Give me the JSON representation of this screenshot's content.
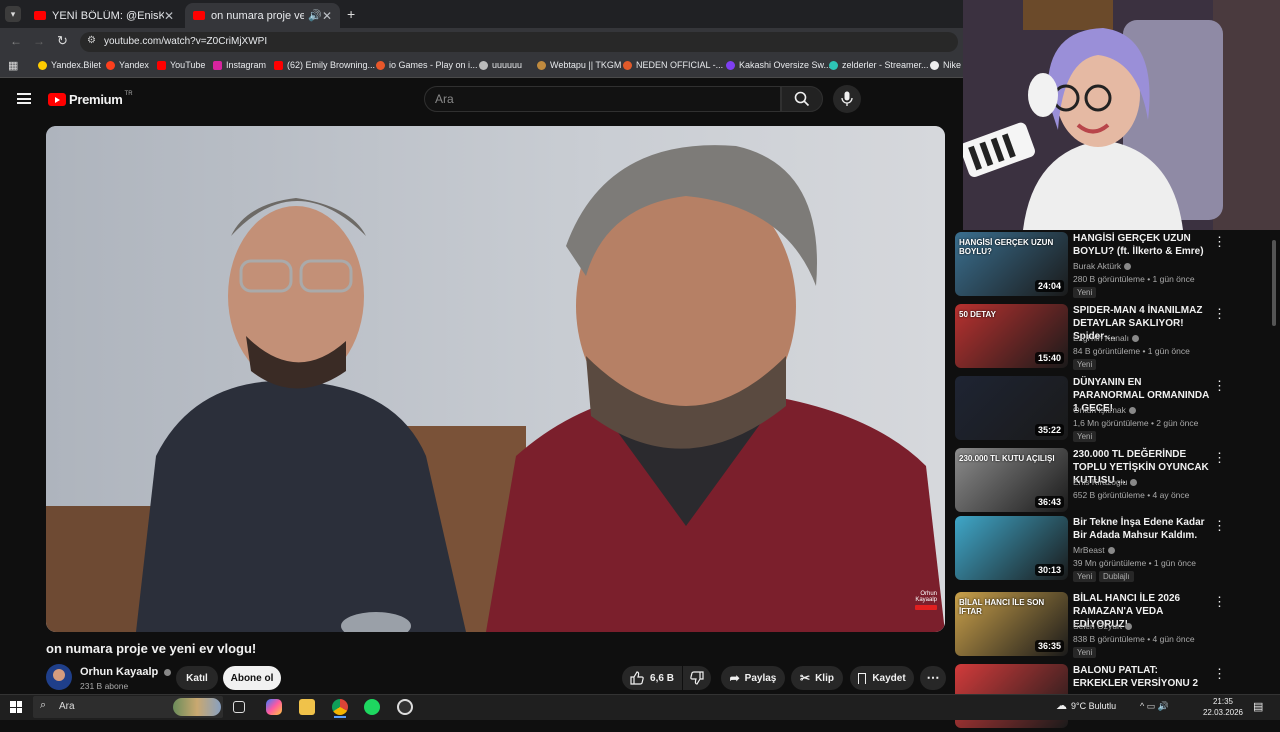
{
  "browser": {
    "tabs": [
      {
        "title": "YENİ BÖLÜM: @EnisKirazogluvlo",
        "active": false
      },
      {
        "title": "on numara proje ve yeni ev",
        "active": true
      }
    ],
    "url": "youtube.com/watch?v=Z0CriMjXWPI",
    "bookmarks": [
      "Yandex.Bilet",
      "Yandex",
      "YouTube",
      "Instagram",
      "(62) Emily Browning...",
      "io Games - Play on i...",
      "uuuuuu",
      "Webtapu || TKGM",
      "NEDEN OFFICIAL -...",
      "Kakashi Oversize Sw...",
      "zelderler - Streamer...",
      "Nike"
    ]
  },
  "youtube": {
    "logo": "Premium",
    "logo_region": "TR",
    "search_placeholder": "Ara"
  },
  "video": {
    "title": "on numara proje ve yeni ev vlogu!",
    "channel": "Orhun Kayaalp",
    "subscribers": "231 B abone",
    "join_label": "Katıl",
    "subscribe_label": "Abone ol",
    "likes": "6,6 B",
    "share_label": "Paylaş",
    "clip_label": "Klip",
    "save_label": "Kaydet",
    "watermark": "Orhun Kayaalp"
  },
  "recommendations": [
    {
      "title": "HANGİSİ GERÇEK UZUN BOYLU? (ft. İlkerto & Emre)",
      "channel": "Burak Aktürk",
      "meta": "280 B görüntüleme • 1 gün önce",
      "duration": "24:04",
      "badge": "Yeni",
      "thumb_text": "HANGİSİ GERÇEK UZUN BOYLU?",
      "thumb_color": "#3a6f8f"
    },
    {
      "title": "SPIDER-MAN 4 İNANILMAZ DETAYLAR SAKLIYOR! Spider-...",
      "channel": "Ezgi'nin Kanalı",
      "meta": "84 B görüntüleme • 1 gün önce",
      "duration": "15:40",
      "badge": "Yeni",
      "thumb_text": "50 DETAY",
      "thumb_color": "#b8312f"
    },
    {
      "title": "DÜNYANIN EN PARANORMAL ORMANINDA 1 GECE!",
      "channel": "Orkun Işıtmak",
      "meta": "1,6 Mn görüntüleme • 2 gün önce",
      "duration": "35:22",
      "badge": "Yeni",
      "thumb_text": "",
      "thumb_color": "#1e2433"
    },
    {
      "title": "230.000 TL DEĞERİNDE TOPLU YETİŞKİN OYUNCAK KUTUSU ...",
      "channel": "Enis Kirazoglu",
      "meta": "652 B görüntüleme • 4 ay önce",
      "duration": "36:43",
      "badge": "",
      "thumb_text": "230.000 TL KUTU AÇILIŞI",
      "thumb_color": "#8c8c8c"
    },
    {
      "title": "Bir Tekne İnşa Edene Kadar Bir Adada Mahsur Kaldım.",
      "channel": "MrBeast",
      "meta": "39 Mn görüntüleme • 1 gün önce",
      "duration": "30:13",
      "badge": "Yeni",
      "badge2": "Dublajlı",
      "thumb_text": "",
      "thumb_color": "#3fa7c9"
    },
    {
      "title": "BİLAL HANCI İLE 2026 RAMAZAN'A VEDA EDİYORUZ!",
      "channel": "Selen Özyurt",
      "meta": "838 B görüntüleme • 4 gün önce",
      "duration": "36:35",
      "badge": "Yeni",
      "thumb_text": "BİLAL HANCI İLE SON İFTAR",
      "thumb_color": "#c9a04a"
    },
    {
      "title": "BALONU PATLAT: ERKEKLER VERSİYONU 2",
      "channel": "",
      "meta": "",
      "duration": "",
      "badge": "",
      "thumb_text": "",
      "thumb_color": "#d23b3b"
    }
  ],
  "taskbar": {
    "search_placeholder": "Ara",
    "weather": "9°C  Bulutlu",
    "time": "21:35",
    "date": "22.03.2026"
  },
  "colors": {
    "accent_red": "#ff0000",
    "background": "#0f0f0f",
    "chip": "#272727"
  }
}
